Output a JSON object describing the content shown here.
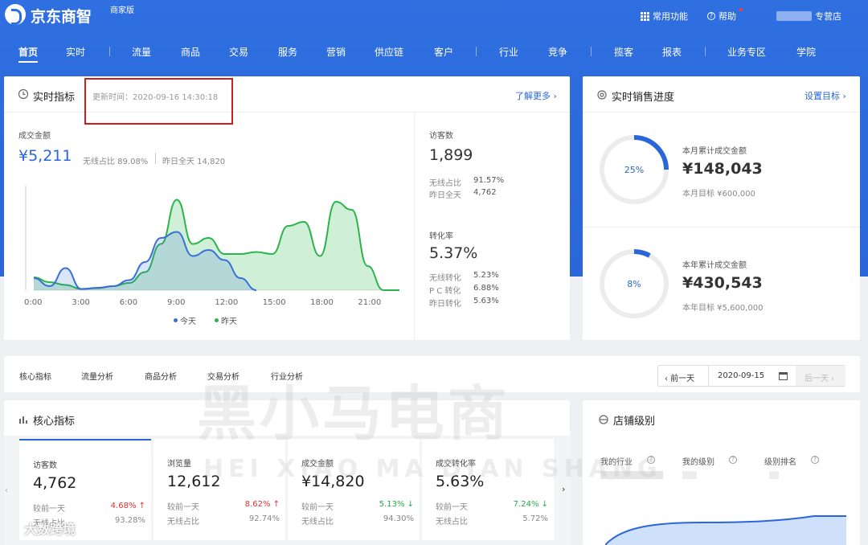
{
  "brand": {
    "name": "京东商智",
    "edition": "商家版"
  },
  "topbar": {
    "common": "常用功能",
    "help": "帮助",
    "store": "专营店"
  },
  "nav": [
    "首页",
    "实时",
    "流量",
    "商品",
    "交易",
    "服务",
    "营销",
    "供应链",
    "客户",
    "行业",
    "竞争",
    "揽客",
    "报表",
    "业务专区",
    "学院"
  ],
  "realtime": {
    "title": "实时指标",
    "updated": "更新时间：2020-09-16 14:30:18",
    "more": "了解更多 ›",
    "gmv_label": "成交金额",
    "gmv": "¥5,211",
    "wireless_share": "无线占比  89.08%",
    "yesterday_total": "昨日全天  14,820",
    "visitors_label": "访客数",
    "visitors": "1,899",
    "v_row1_label": "无线占比",
    "v_row1_value": "91.57%",
    "v_row2_label": "昨日全天",
    "v_row2_value": "4,762",
    "conv_label": "转化率",
    "conv": "5.37%",
    "c_row1_label": "无线转化",
    "c_row1_value": "5.23%",
    "c_row2_label": "P C 转化",
    "c_row2_value": "6.88%",
    "c_row3_label": "昨日转化",
    "c_row3_value": "5.63%"
  },
  "chart_data": {
    "type": "area",
    "x": [
      "0:00",
      "1:00",
      "2:00",
      "3:00",
      "4:00",
      "5:00",
      "6:00",
      "7:00",
      "8:00",
      "9:00",
      "10:00",
      "11:00",
      "12:00",
      "13:00",
      "14:00",
      "15:00",
      "16:00",
      "17:00",
      "18:00",
      "19:00",
      "20:00",
      "21:00",
      "22:00",
      "23:00"
    ],
    "x_ticks": [
      "0:00",
      "3:00",
      "6:00",
      "9:00",
      "12:00",
      "15:00",
      "18:00",
      "21:00"
    ],
    "series": [
      {
        "name": "今天",
        "color": "#3a6fd8",
        "values": [
          300,
          100,
          550,
          30,
          60,
          100,
          250,
          700,
          1300,
          1450,
          850,
          1000,
          750,
          300,
          0
        ]
      },
      {
        "name": "昨天",
        "color": "#2bb44a",
        "values": [
          320,
          200,
          130,
          30,
          50,
          100,
          180,
          450,
          1150,
          2250,
          1150,
          1300,
          900,
          900,
          950,
          900,
          1600,
          1700,
          850,
          2200,
          2000,
          600,
          0,
          0
        ]
      }
    ],
    "ylim": [
      0,
      2600
    ]
  },
  "sales": {
    "title": "实时销售进度",
    "set_goal": "设置目标 ›",
    "month": {
      "pct": "25%",
      "pct_value": 25,
      "label": "本月累计成交金额",
      "value": "¥148,043",
      "target": "本月目标  ¥600,000"
    },
    "year": {
      "pct": "8%",
      "pct_value": 8,
      "label": "本年累计成交金额",
      "value": "¥430,543",
      "target": "本年目标  ¥5,600,000"
    }
  },
  "tabs": [
    "核心指标",
    "流量分析",
    "商品分析",
    "交易分析",
    "行业分析"
  ],
  "datepicker": {
    "prev": "‹ 前一天",
    "date": "2020-09-15",
    "next": "后一天 ›"
  },
  "core": {
    "title": "核心指标",
    "cards": [
      {
        "t": "访客数",
        "v": "4,762",
        "r1l": "较前一天",
        "r1v": "4.68% ↑",
        "r1c": "up",
        "r2l": "无线占比",
        "r2v": "93.28%"
      },
      {
        "t": "浏览量",
        "v": "12,612",
        "r1l": "较前一天",
        "r1v": "8.62% ↑",
        "r1c": "up",
        "r2l": "无线占比",
        "r2v": "92.74%"
      },
      {
        "t": "成交金额",
        "v": "¥14,820",
        "r1l": "较前一天",
        "r1v": "5.13% ↓",
        "r1c": "down",
        "r2l": "无线占比",
        "r2v": "94.30%"
      },
      {
        "t": "成交转化率",
        "v": "5.63%",
        "r1l": "较前一天",
        "r1v": "7.24% ↓",
        "r1c": "down",
        "r2l": "无线占比",
        "r2v": "5.72%"
      }
    ]
  },
  "level": {
    "title": "店铺级别",
    "industry": "我的行业",
    "my_level": "我的级别",
    "rank": "级别排名"
  },
  "watermark": {
    "cn": "黑小马电商",
    "en": "HEI XIAO MA DIAN SHANG",
    "source": "大数跨境"
  }
}
